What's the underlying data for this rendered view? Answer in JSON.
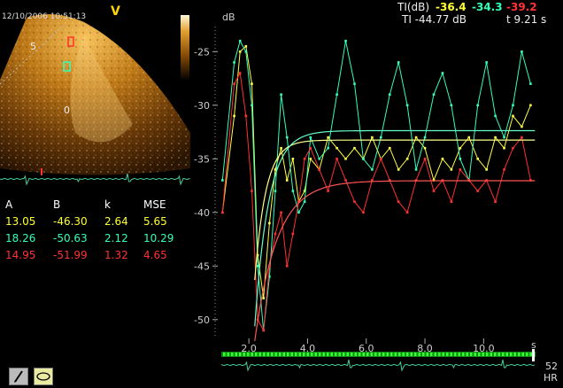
{
  "image_timestamp": "12/10/2006 10:51:13",
  "image_mode_letter": "V",
  "depth_labels": [
    "5",
    "0"
  ],
  "roi_labels": [
    {
      "id": "roi-red"
    },
    {
      "id": "roi-cyan"
    }
  ],
  "fit_table": {
    "headers": [
      "A",
      "B",
      "k",
      "MSE"
    ],
    "rows": [
      {
        "color": "#ffff33",
        "values": [
          "13.05",
          "-46.30",
          "2.64",
          "5.65"
        ]
      },
      {
        "color": "#33ffbb",
        "values": [
          "18.26",
          "-50.63",
          "2.12",
          "10.29"
        ]
      },
      {
        "color": "#ff3333",
        "values": [
          "14.95",
          "-51.99",
          "1.32",
          "4.65"
        ]
      }
    ]
  },
  "ti_readout": {
    "label": "TI(dB)",
    "values": [
      {
        "text": "-36.4",
        "color": "#ffff33"
      },
      {
        "text": "-34.3",
        "color": "#33ffbb"
      },
      {
        "text": "-39.2",
        "color": "#ff3333"
      }
    ],
    "second_label": "TI -44.77 dB",
    "time": "t 9.21 s"
  },
  "heart_rate": {
    "value": "52",
    "unit": "HR"
  },
  "tools": [
    {
      "name": "pencil-tool"
    },
    {
      "name": "ellipse-tool"
    }
  ],
  "chart_data": {
    "type": "line",
    "ylabel": "dB",
    "xlabel": "s",
    "ylim": [
      -52,
      -22
    ],
    "xlim": [
      1.0,
      11.8
    ],
    "yticks": [
      "-25",
      "-30",
      "-35",
      "-40",
      "-45",
      "-50"
    ],
    "xticks": [
      "2.0",
      "4.0",
      "6.0",
      "8.0",
      "10.0"
    ],
    "series": [
      {
        "color": "#ffff44",
        "x": [
          1.1,
          1.5,
          1.7,
          1.9,
          2.1,
          2.3,
          2.5,
          2.7,
          2.9,
          3.1,
          3.3,
          3.5,
          3.7,
          3.9,
          4.1,
          4.4,
          4.7,
          5.0,
          5.3,
          5.6,
          5.9,
          6.2,
          6.5,
          6.8,
          7.1,
          7.4,
          7.7,
          8.0,
          8.3,
          8.6,
          8.9,
          9.2,
          9.5,
          9.8,
          10.1,
          10.4,
          10.7,
          11.0,
          11.3,
          11.6
        ],
        "y": [
          -40,
          -31,
          -25,
          -24.5,
          -28,
          -44,
          -48,
          -41,
          -36,
          -34,
          -37,
          -35,
          -39,
          -38,
          -35,
          -36,
          -33,
          -34,
          -35,
          -34,
          -35,
          -33,
          -35,
          -34,
          -36,
          -35,
          -33,
          -34,
          -37,
          -35,
          -36,
          -34,
          -33,
          -35,
          -36,
          -33,
          -34,
          -31,
          -32,
          -30
        ]
      },
      {
        "color": "#33ffbb",
        "x": [
          1.1,
          1.5,
          1.7,
          1.9,
          2.1,
          2.3,
          2.5,
          2.7,
          2.9,
          3.1,
          3.3,
          3.5,
          3.7,
          3.9,
          4.1,
          4.4,
          4.7,
          5.0,
          5.3,
          5.6,
          5.9,
          6.2,
          6.5,
          6.8,
          7.1,
          7.4,
          7.7,
          8.0,
          8.3,
          8.6,
          8.9,
          9.2,
          9.5,
          9.8,
          10.1,
          10.4,
          10.7,
          11.0,
          11.3,
          11.6
        ],
        "y": [
          -37,
          -26,
          -24,
          -25,
          -30,
          -45,
          -51,
          -46,
          -38,
          -29,
          -33,
          -38,
          -40,
          -39,
          -33,
          -35,
          -34,
          -29,
          -24,
          -28,
          -35,
          -36,
          -33,
          -29,
          -26,
          -30,
          -36,
          -33,
          -29,
          -27,
          -30,
          -35,
          -37,
          -30,
          -26,
          -31,
          -33,
          -30,
          -25,
          -28
        ]
      },
      {
        "color": "#ff3030",
        "x": [
          1.1,
          1.5,
          1.7,
          1.9,
          2.1,
          2.3,
          2.5,
          2.7,
          2.9,
          3.1,
          3.3,
          3.5,
          3.7,
          3.9,
          4.1,
          4.4,
          4.7,
          5.0,
          5.3,
          5.6,
          5.9,
          6.2,
          6.5,
          6.8,
          7.1,
          7.4,
          7.7,
          8.0,
          8.3,
          8.6,
          8.9,
          9.2,
          9.5,
          9.8,
          10.1,
          10.4,
          10.7,
          11.0,
          11.3,
          11.6
        ],
        "y": [
          -40,
          -28,
          -27,
          -31,
          -38,
          -50,
          -51,
          -45,
          -42,
          -40,
          -45,
          -42,
          -39,
          -35,
          -34,
          -36,
          -38,
          -35,
          -37,
          -39,
          -40,
          -37,
          -35,
          -37,
          -39,
          -40,
          -37,
          -35,
          -38,
          -37,
          -39,
          -36,
          -37,
          -38,
          -37,
          -39,
          -36,
          -34,
          -33,
          -37
        ]
      }
    ],
    "fit_curves": [
      {
        "color": "#ffff88",
        "A": 13.05,
        "B": -46.3,
        "k": 2.64,
        "t0": 2.2
      },
      {
        "color": "#66ffcc",
        "A": 18.26,
        "B": -50.63,
        "k": 2.12,
        "t0": 2.2
      },
      {
        "color": "#ff5555",
        "A": 14.95,
        "B": -51.99,
        "k": 1.32,
        "t0": 2.2
      }
    ]
  }
}
